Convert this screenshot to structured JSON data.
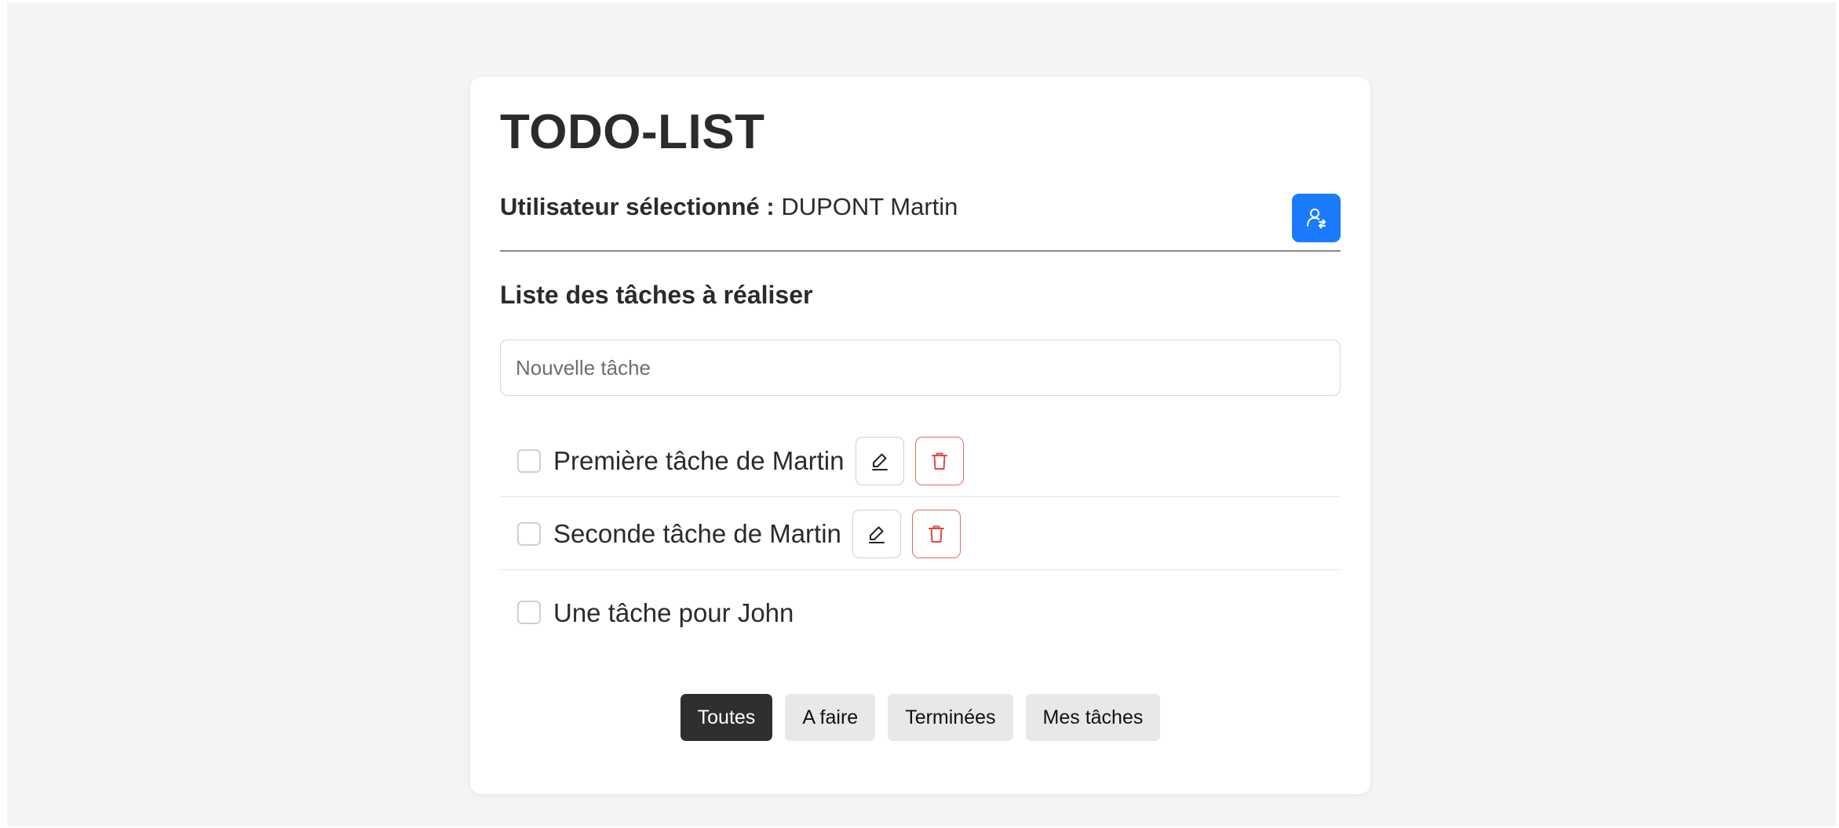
{
  "app": {
    "title": "TODO-LIST"
  },
  "user": {
    "label": "Utilisateur sélectionné :",
    "name": "DUPONT Martin",
    "button_icon": "user-switch-icon"
  },
  "tasks_section": {
    "title": "Liste des tâches à réaliser",
    "new_task_placeholder": "Nouvelle tâche",
    "new_task_value": ""
  },
  "tasks": [
    {
      "label": "Première tâche de Martin",
      "done": false,
      "editable": true
    },
    {
      "label": "Seconde tâche de Martin",
      "done": false,
      "editable": true
    },
    {
      "label": "Une tâche pour John",
      "done": false,
      "editable": false
    }
  ],
  "filters": [
    {
      "label": "Toutes",
      "active": true
    },
    {
      "label": "A faire",
      "active": false
    },
    {
      "label": "Terminées",
      "active": false
    },
    {
      "label": "Mes tâches",
      "active": false
    }
  ],
  "colors": {
    "primary": "#1a7bfc",
    "danger": "#e26868",
    "active_filter": "#2f2f2f",
    "background": "#f4f4f4"
  },
  "icons": {
    "edit": "pencil-icon",
    "delete": "trash-icon"
  }
}
